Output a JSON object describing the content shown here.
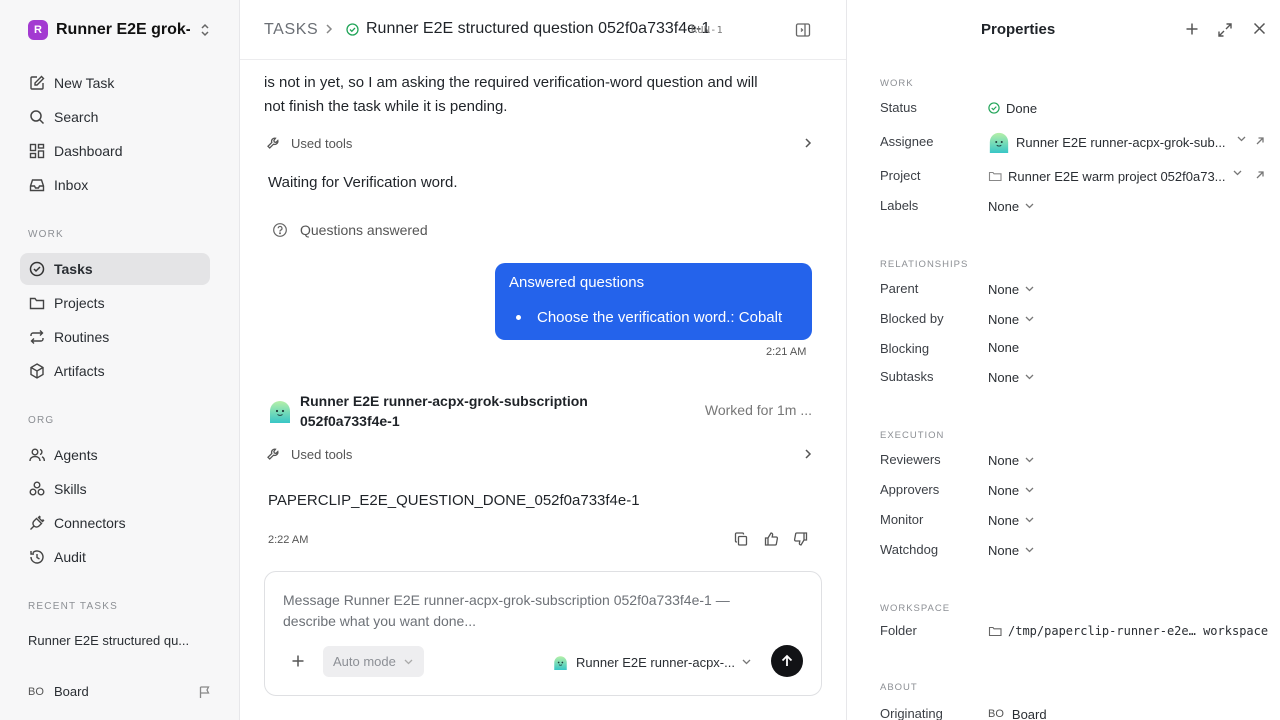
{
  "sidebar": {
    "workspace_initial": "R",
    "workspace_name": "Runner E2E grok-...",
    "items": [
      {
        "label": "New Task",
        "icon": "edit-icon"
      },
      {
        "label": "Search",
        "icon": "search-icon"
      },
      {
        "label": "Dashboard",
        "icon": "dashboard-icon"
      },
      {
        "label": "Inbox",
        "icon": "inbox-icon"
      }
    ],
    "work_label": "WORK",
    "work_items": [
      {
        "label": "Tasks",
        "icon": "check-circle-icon",
        "active": true
      },
      {
        "label": "Projects",
        "icon": "folder-icon"
      },
      {
        "label": "Routines",
        "icon": "repeat-icon"
      },
      {
        "label": "Artifacts",
        "icon": "box-icon"
      }
    ],
    "org_label": "ORG",
    "org_items": [
      {
        "label": "Agents",
        "icon": "users-icon"
      },
      {
        "label": "Skills",
        "icon": "skills-icon"
      },
      {
        "label": "Connectors",
        "icon": "plug-icon"
      },
      {
        "label": "Audit",
        "icon": "history-icon"
      }
    ],
    "recent_label": "RECENT TASKS",
    "recent_item": "Runner E2E structured qu...",
    "board_initials": "BO",
    "board_label": "Board"
  },
  "header": {
    "tasks_crumb": "TASKS",
    "task_title": "Runner E2E structured question 052f0a733f4e-1",
    "run_badge": "RUN-1"
  },
  "chat": {
    "msg_line1": "is not in yet, so I am asking the required verification-word question and will",
    "msg_line2": "not finish the task while it is pending.",
    "used_tools": "Used tools",
    "waiting": "Waiting for Verification word.",
    "questions_answered": "Questions answered",
    "bubble_title": "Answered questions",
    "bubble_item": "Choose the verification word.: Cobalt",
    "bubble_time": "2:21 AM",
    "agent_name_line1": "Runner E2E runner-acpx-grok-subscription",
    "agent_name_line2": "052f0a733f4e-1",
    "worked_for": "Worked for 1m ...",
    "used_tools_2": "Used tools",
    "final_text": "PAPERCLIP_E2E_QUESTION_DONE_052f0a733f4e-1",
    "final_time": "2:22 AM"
  },
  "composer": {
    "placeholder": "Message Runner E2E runner-acpx-grok-subscription 052f0a733f4e-1 — describe what you want done...",
    "mode": "Auto mode",
    "agent": "Runner E2E runner-acpx-..."
  },
  "properties": {
    "title": "Properties",
    "work_label": "WORK",
    "status_label": "Status",
    "status_value": "Done",
    "assignee_label": "Assignee",
    "assignee_value": "Runner E2E runner-acpx-grok-sub...",
    "project_label": "Project",
    "project_value": "Runner E2E warm project 052f0a73...",
    "labels_label": "Labels",
    "labels_value": "None",
    "relationships_label": "RELATIONSHIPS",
    "parent_label": "Parent",
    "parent_value": "None",
    "blocked_by_label": "Blocked by",
    "blocked_by_value": "None",
    "blocking_label": "Blocking",
    "blocking_value": "None",
    "subtasks_label": "Subtasks",
    "subtasks_value": "None",
    "execution_label": "EXECUTION",
    "reviewers_label": "Reviewers",
    "reviewers_value": "None",
    "approvers_label": "Approvers",
    "approvers_value": "None",
    "monitor_label": "Monitor",
    "monitor_value": "None",
    "watchdog_label": "Watchdog",
    "watchdog_value": "None",
    "workspace_label": "WORKSPACE",
    "folder_label": "Folder",
    "folder_value": "/tmp/paperclip-runner-e2e… workspace",
    "about_label": "ABOUT",
    "originating_label": "Originating",
    "originating_initials": "BO",
    "originating_value": "Board"
  },
  "colors": {
    "accent_blue": "#2463eb",
    "status_green": "#22a559",
    "workspace_purple": "#a33ad1",
    "active_nav_bg": "#e4e4e6"
  }
}
